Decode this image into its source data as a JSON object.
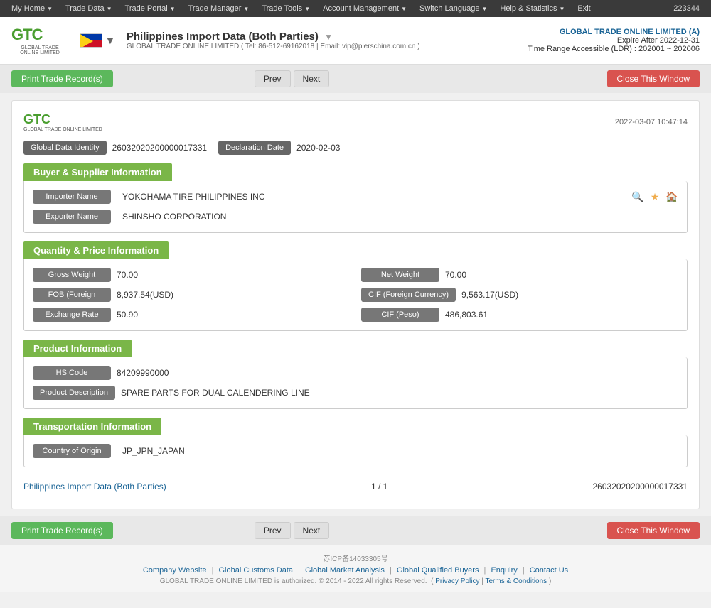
{
  "topnav": {
    "items": [
      {
        "label": "My Home",
        "arrow": true
      },
      {
        "label": "Trade Data",
        "arrow": true
      },
      {
        "label": "Trade Portal",
        "arrow": true
      },
      {
        "label": "Trade Manager",
        "arrow": true
      },
      {
        "label": "Trade Tools",
        "arrow": true
      },
      {
        "label": "Account Management",
        "arrow": true
      },
      {
        "label": "Switch Language",
        "arrow": true
      },
      {
        "label": "Help & Statistics",
        "arrow": true
      },
      {
        "label": "Exit",
        "arrow": false
      }
    ],
    "user_id": "223344"
  },
  "header": {
    "logo_text": "GTC",
    "logo_sub": "GLOBAL TRADE ONLINE LIMITED",
    "flag_alt": "Philippines",
    "title": "Philippines Import Data (Both Parties)",
    "subtitle": "GLOBAL TRADE ONLINE LIMITED ( Tel: 86-512-69162018 | Email: vip@pierschina.com.cn )",
    "company": "GLOBAL TRADE ONLINE LIMITED (A)",
    "expire": "Expire After 2022-12-31",
    "time_range": "Time Range Accessible (LDR) : 202001 ~ 202006"
  },
  "actions": {
    "print_label": "Print Trade Record(s)",
    "prev_label": "Prev",
    "next_label": "Next",
    "close_label": "Close This Window"
  },
  "record": {
    "timestamp": "2022-03-07 10:47:14",
    "global_data_identity_label": "Global Data Identity",
    "global_data_identity_value": "26032020200000017331",
    "declaration_date_label": "Declaration Date",
    "declaration_date_value": "2020-02-03",
    "sections": {
      "buyer_supplier": {
        "title": "Buyer & Supplier Information",
        "importer_label": "Importer Name",
        "importer_value": "YOKOHAMA TIRE PHILIPPINES INC",
        "exporter_label": "Exporter Name",
        "exporter_value": "SHINSHO CORPORATION"
      },
      "quantity_price": {
        "title": "Quantity & Price Information",
        "gross_weight_label": "Gross Weight",
        "gross_weight_value": "70.00",
        "net_weight_label": "Net Weight",
        "net_weight_value": "70.00",
        "fob_label": "FOB (Foreign",
        "fob_value": "8,937.54(USD)",
        "cif_foreign_label": "CIF (Foreign Currency)",
        "cif_foreign_value": "9,563.17(USD)",
        "exchange_rate_label": "Exchange Rate",
        "exchange_rate_value": "50.90",
        "cif_peso_label": "CIF (Peso)",
        "cif_peso_value": "486,803.61"
      },
      "product": {
        "title": "Product Information",
        "hs_code_label": "HS Code",
        "hs_code_value": "84209990000",
        "product_desc_label": "Product Description",
        "product_desc_value": "SPARE PARTS FOR DUAL CALENDERING LINE"
      },
      "transportation": {
        "title": "Transportation Information",
        "country_origin_label": "Country of Origin",
        "country_origin_value": "JP_JPN_JAPAN"
      }
    },
    "footer": {
      "title": "Philippines Import Data (Both Parties)",
      "pagination": "1 / 1",
      "record_id": "26032020200000017331"
    }
  },
  "footer": {
    "icp": "苏ICP备14033305号",
    "links": [
      "Company Website",
      "Global Customs Data",
      "Global Market Analysis",
      "Global Qualified Buyers",
      "Enquiry",
      "Contact Us"
    ],
    "copyright": "GLOBAL TRADE ONLINE LIMITED is authorized. © 2014 - 2022 All rights Reserved.  ( Privacy Policy | Terms & Conditions )"
  }
}
